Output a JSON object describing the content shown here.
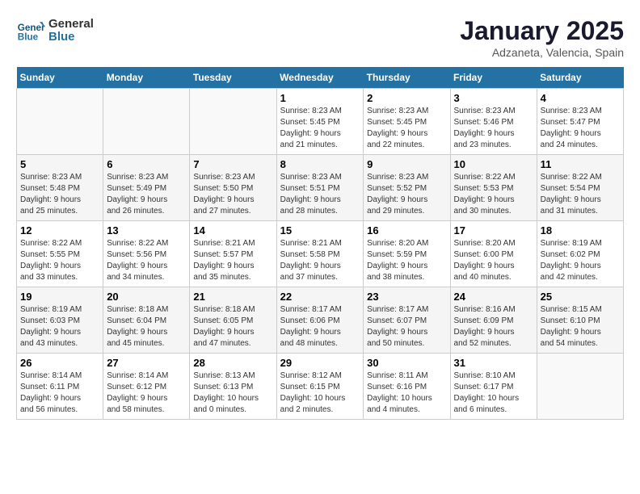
{
  "logo": {
    "text_general": "General",
    "text_blue": "Blue"
  },
  "header": {
    "title": "January 2025",
    "subtitle": "Adzaneta, Valencia, Spain"
  },
  "weekdays": [
    "Sunday",
    "Monday",
    "Tuesday",
    "Wednesday",
    "Thursday",
    "Friday",
    "Saturday"
  ],
  "weeks": [
    [
      {
        "day": "",
        "info": ""
      },
      {
        "day": "",
        "info": ""
      },
      {
        "day": "",
        "info": ""
      },
      {
        "day": "1",
        "info": "Sunrise: 8:23 AM\nSunset: 5:45 PM\nDaylight: 9 hours\nand 21 minutes."
      },
      {
        "day": "2",
        "info": "Sunrise: 8:23 AM\nSunset: 5:45 PM\nDaylight: 9 hours\nand 22 minutes."
      },
      {
        "day": "3",
        "info": "Sunrise: 8:23 AM\nSunset: 5:46 PM\nDaylight: 9 hours\nand 23 minutes."
      },
      {
        "day": "4",
        "info": "Sunrise: 8:23 AM\nSunset: 5:47 PM\nDaylight: 9 hours\nand 24 minutes."
      }
    ],
    [
      {
        "day": "5",
        "info": "Sunrise: 8:23 AM\nSunset: 5:48 PM\nDaylight: 9 hours\nand 25 minutes."
      },
      {
        "day": "6",
        "info": "Sunrise: 8:23 AM\nSunset: 5:49 PM\nDaylight: 9 hours\nand 26 minutes."
      },
      {
        "day": "7",
        "info": "Sunrise: 8:23 AM\nSunset: 5:50 PM\nDaylight: 9 hours\nand 27 minutes."
      },
      {
        "day": "8",
        "info": "Sunrise: 8:23 AM\nSunset: 5:51 PM\nDaylight: 9 hours\nand 28 minutes."
      },
      {
        "day": "9",
        "info": "Sunrise: 8:23 AM\nSunset: 5:52 PM\nDaylight: 9 hours\nand 29 minutes."
      },
      {
        "day": "10",
        "info": "Sunrise: 8:22 AM\nSunset: 5:53 PM\nDaylight: 9 hours\nand 30 minutes."
      },
      {
        "day": "11",
        "info": "Sunrise: 8:22 AM\nSunset: 5:54 PM\nDaylight: 9 hours\nand 31 minutes."
      }
    ],
    [
      {
        "day": "12",
        "info": "Sunrise: 8:22 AM\nSunset: 5:55 PM\nDaylight: 9 hours\nand 33 minutes."
      },
      {
        "day": "13",
        "info": "Sunrise: 8:22 AM\nSunset: 5:56 PM\nDaylight: 9 hours\nand 34 minutes."
      },
      {
        "day": "14",
        "info": "Sunrise: 8:21 AM\nSunset: 5:57 PM\nDaylight: 9 hours\nand 35 minutes."
      },
      {
        "day": "15",
        "info": "Sunrise: 8:21 AM\nSunset: 5:58 PM\nDaylight: 9 hours\nand 37 minutes."
      },
      {
        "day": "16",
        "info": "Sunrise: 8:20 AM\nSunset: 5:59 PM\nDaylight: 9 hours\nand 38 minutes."
      },
      {
        "day": "17",
        "info": "Sunrise: 8:20 AM\nSunset: 6:00 PM\nDaylight: 9 hours\nand 40 minutes."
      },
      {
        "day": "18",
        "info": "Sunrise: 8:19 AM\nSunset: 6:02 PM\nDaylight: 9 hours\nand 42 minutes."
      }
    ],
    [
      {
        "day": "19",
        "info": "Sunrise: 8:19 AM\nSunset: 6:03 PM\nDaylight: 9 hours\nand 43 minutes."
      },
      {
        "day": "20",
        "info": "Sunrise: 8:18 AM\nSunset: 6:04 PM\nDaylight: 9 hours\nand 45 minutes."
      },
      {
        "day": "21",
        "info": "Sunrise: 8:18 AM\nSunset: 6:05 PM\nDaylight: 9 hours\nand 47 minutes."
      },
      {
        "day": "22",
        "info": "Sunrise: 8:17 AM\nSunset: 6:06 PM\nDaylight: 9 hours\nand 48 minutes."
      },
      {
        "day": "23",
        "info": "Sunrise: 8:17 AM\nSunset: 6:07 PM\nDaylight: 9 hours\nand 50 minutes."
      },
      {
        "day": "24",
        "info": "Sunrise: 8:16 AM\nSunset: 6:09 PM\nDaylight: 9 hours\nand 52 minutes."
      },
      {
        "day": "25",
        "info": "Sunrise: 8:15 AM\nSunset: 6:10 PM\nDaylight: 9 hours\nand 54 minutes."
      }
    ],
    [
      {
        "day": "26",
        "info": "Sunrise: 8:14 AM\nSunset: 6:11 PM\nDaylight: 9 hours\nand 56 minutes."
      },
      {
        "day": "27",
        "info": "Sunrise: 8:14 AM\nSunset: 6:12 PM\nDaylight: 9 hours\nand 58 minutes."
      },
      {
        "day": "28",
        "info": "Sunrise: 8:13 AM\nSunset: 6:13 PM\nDaylight: 10 hours\nand 0 minutes."
      },
      {
        "day": "29",
        "info": "Sunrise: 8:12 AM\nSunset: 6:15 PM\nDaylight: 10 hours\nand 2 minutes."
      },
      {
        "day": "30",
        "info": "Sunrise: 8:11 AM\nSunset: 6:16 PM\nDaylight: 10 hours\nand 4 minutes."
      },
      {
        "day": "31",
        "info": "Sunrise: 8:10 AM\nSunset: 6:17 PM\nDaylight: 10 hours\nand 6 minutes."
      },
      {
        "day": "",
        "info": ""
      }
    ]
  ]
}
